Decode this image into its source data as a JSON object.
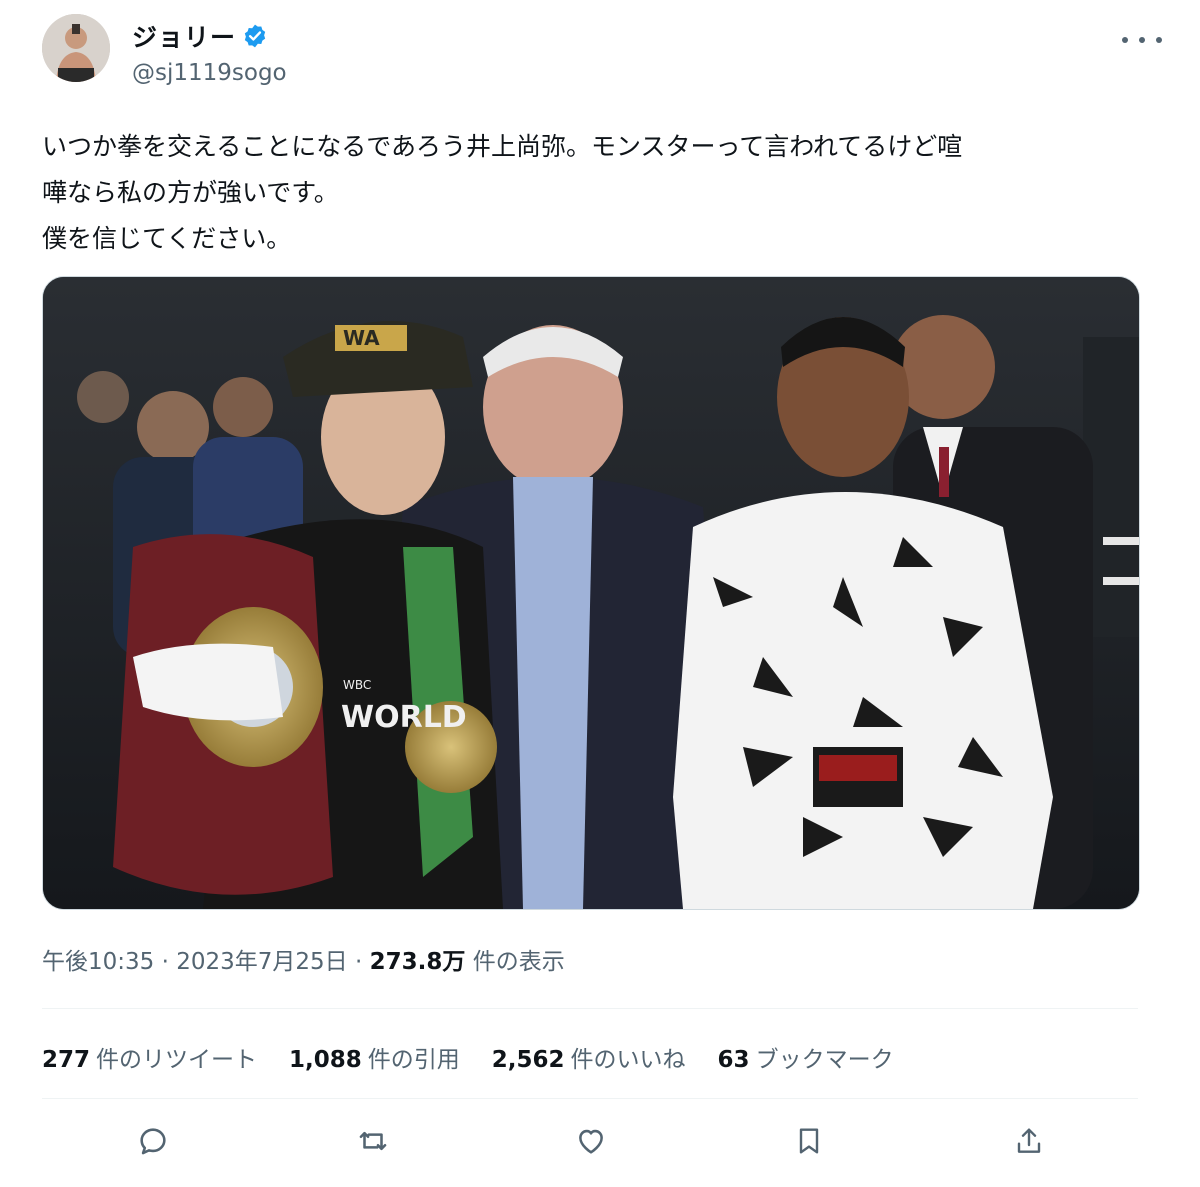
{
  "user": {
    "display_name": "ジョリー",
    "handle": "@sj1119sogo"
  },
  "tweet": {
    "lines": [
      "いつか拳を交えることになるであろう井上尚弥。モンスターって言われてるけど喧",
      "嘩なら私の方が強いです。",
      "僕を信じてください。"
    ]
  },
  "media": {
    "cap_text": "WA",
    "belt_text": "WORLD",
    "belt_badge": "WBC"
  },
  "meta": {
    "time": "午後10:35",
    "sep": "·",
    "date": "2023年7月25日",
    "views_count": "273.8万",
    "views_label": "件の表示"
  },
  "stats": {
    "retweets": {
      "count": "277",
      "label": "件のリツイート"
    },
    "quotes": {
      "count": "1,088",
      "label": "件の引用"
    },
    "likes": {
      "count": "2,562",
      "label": "件のいいね"
    },
    "bookmarks": {
      "count": "63",
      "label": "ブックマーク"
    }
  },
  "icons": {
    "verified": "verified-badge-icon",
    "more": "more-icon",
    "reply": "reply-icon",
    "retweet": "retweet-icon",
    "like": "heart-icon",
    "bookmark": "bookmark-icon",
    "share": "share-icon"
  },
  "colors": {
    "verified": "#1d9bf0",
    "secondary_text": "#536471",
    "primary_text": "#0f1419"
  }
}
